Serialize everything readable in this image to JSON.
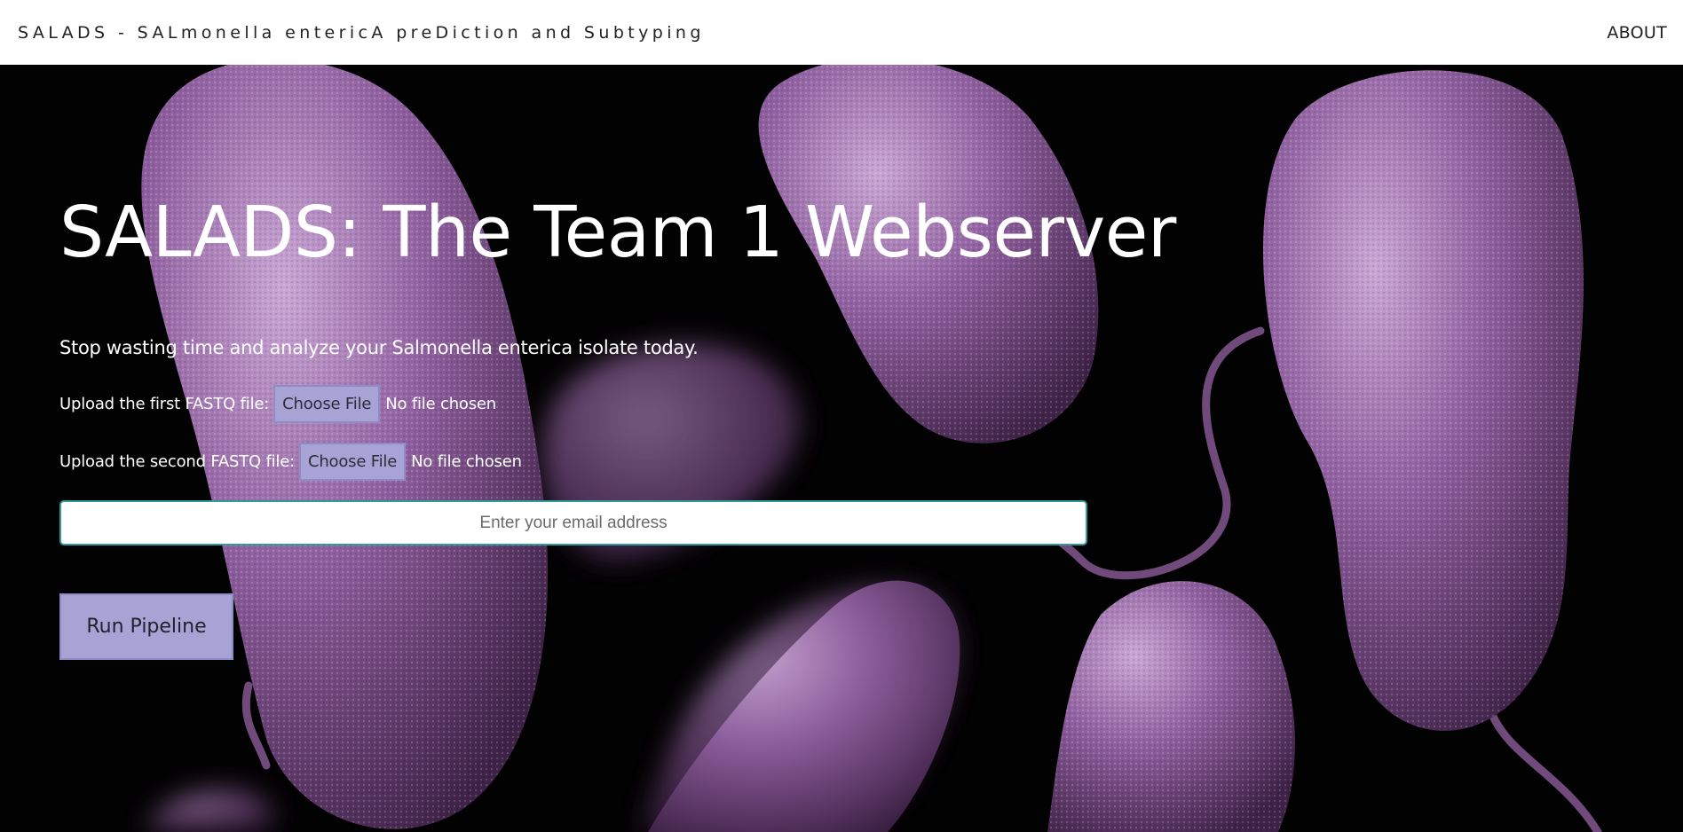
{
  "header": {
    "brand": "SALADS - SALmonella entericA preDiction and Subtyping",
    "about_label": "ABOUT"
  },
  "hero": {
    "background_image": "purple rod-shaped Salmonella bacteria on black background",
    "title": "SALADS: The Team 1 Webserver",
    "tagline": "Stop wasting time and analyze your Salmonella enterica isolate today.",
    "upload_first": {
      "label": "Upload the first FASTQ file:",
      "button": "Choose File",
      "status": "No file chosen"
    },
    "upload_second": {
      "label": "Upload the second FASTQ file:",
      "button": "Choose File",
      "status": "No file chosen"
    },
    "email": {
      "placeholder": "Enter your email address",
      "value": ""
    },
    "run_label": "Run Pipeline"
  },
  "colors": {
    "button_fill": "#a7a3d4",
    "email_border": "#2f9b9a",
    "background": "#030203",
    "bacteria": "#8a5a98"
  }
}
